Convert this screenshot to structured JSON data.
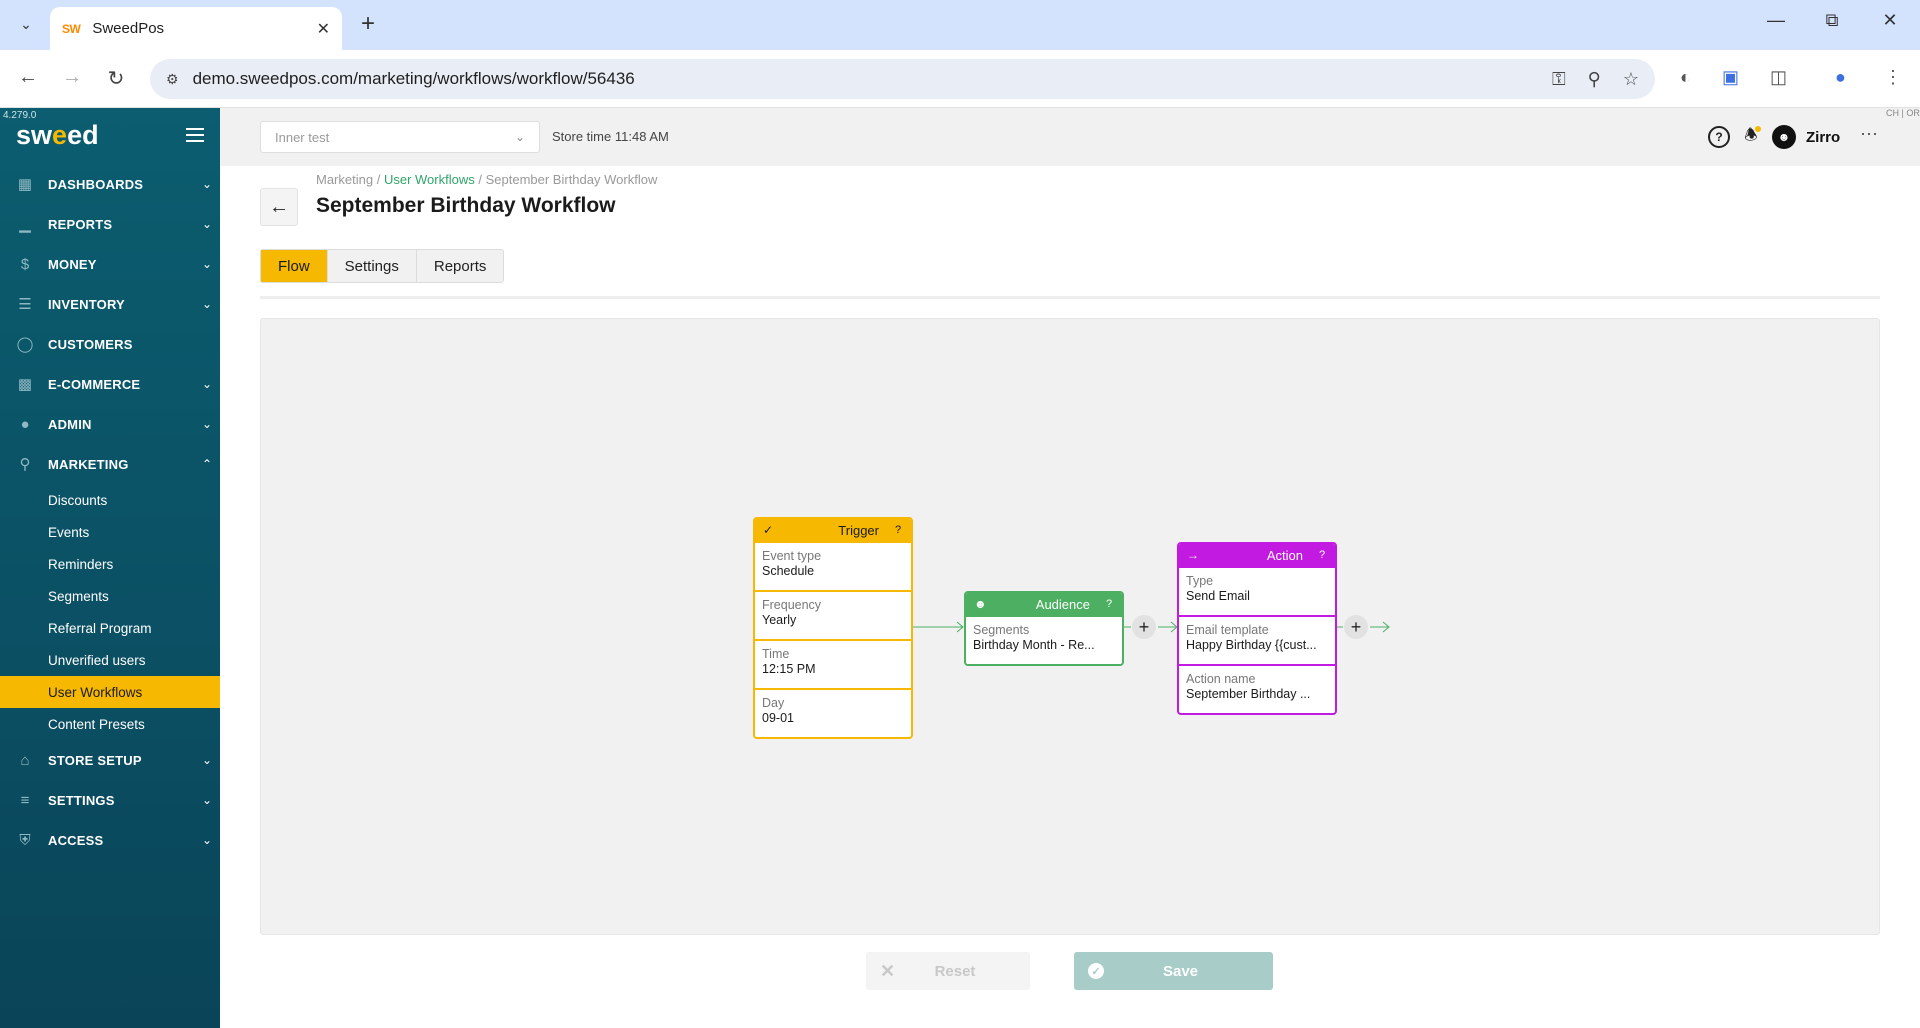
{
  "browser": {
    "tab_title": "SweedPos",
    "favicon_text": "SW",
    "url": "demo.sweedpos.com/marketing/workflows/workflow/56436"
  },
  "sidebar": {
    "version": "4.279.0",
    "logo": "sweed",
    "sections": [
      {
        "label": "DASHBOARDS",
        "icon": "dashboard-icon"
      },
      {
        "label": "REPORTS",
        "icon": "bar-chart-icon"
      },
      {
        "label": "MONEY",
        "icon": "dollar-icon"
      },
      {
        "label": "INVENTORY",
        "icon": "list-icon"
      },
      {
        "label": "CUSTOMERS",
        "icon": "user-icon"
      },
      {
        "label": "E-COMMERCE",
        "icon": "basket-icon"
      },
      {
        "label": "ADMIN",
        "icon": "admin-user-icon"
      },
      {
        "label": "MARKETING",
        "icon": "search-icon"
      }
    ],
    "marketing_items": [
      "Discounts",
      "Events",
      "Reminders",
      "Segments",
      "Referral Program",
      "Unverified users",
      "User Workflows",
      "Content Presets"
    ],
    "active_item": "User Workflows",
    "bottom_sections": [
      {
        "label": "STORE SETUP",
        "icon": "home-icon"
      },
      {
        "label": "SETTINGS",
        "icon": "sliders-icon"
      },
      {
        "label": "ACCESS",
        "icon": "shield-icon"
      }
    ]
  },
  "topbar": {
    "store_placeholder": "Inner test",
    "store_time": "Store time 11:48 AM",
    "username": "Zirro",
    "corner_text": "CH | OR"
  },
  "page": {
    "breadcrumb": {
      "root": "Marketing",
      "section": "User Workflows",
      "current": "September Birthday Workflow",
      "separator": "/"
    },
    "title": "September Birthday Workflow",
    "tabs": [
      "Flow",
      "Settings",
      "Reports"
    ],
    "active_tab": "Flow"
  },
  "workflow": {
    "trigger": {
      "title": "Trigger",
      "help": "?",
      "fields": [
        {
          "label": "Event type",
          "value": "Schedule"
        },
        {
          "label": "Frequency",
          "value": "Yearly"
        },
        {
          "label": "Time",
          "value": "12:15 PM"
        },
        {
          "label": "Day",
          "value": "09-01"
        }
      ]
    },
    "audience": {
      "title": "Audience",
      "help": "?",
      "fields": [
        {
          "label": "Segments",
          "value": "Birthday Month - Re..."
        }
      ]
    },
    "action": {
      "title": "Action",
      "help": "?",
      "fields": [
        {
          "label": "Type",
          "value": "Send Email"
        },
        {
          "label": "Email template",
          "value": "Happy Birthday {{cust..."
        },
        {
          "label": "Action name",
          "value": "September Birthday ..."
        }
      ]
    },
    "colors": {
      "trigger": "#f6b800",
      "audience": "#4caf62",
      "action": "#c21ae0",
      "connector": "#4caf62"
    }
  },
  "footer": {
    "reset_label": "Reset",
    "save_label": "Save"
  }
}
